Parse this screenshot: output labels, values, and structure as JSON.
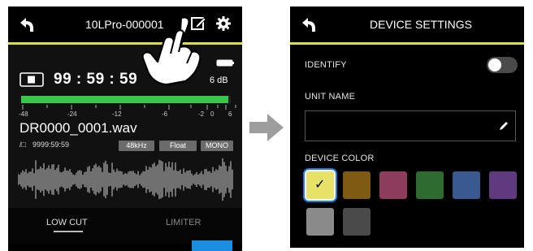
{
  "left_screen": {
    "header_title": "10LPro-000001",
    "timecode": "99 : 59 : 59",
    "level_readout": "6 dB",
    "scale_labels": [
      "-48",
      "-24",
      "-12",
      "-6",
      "-2",
      "0",
      "6"
    ],
    "file_name": "DR0000_0001.wav",
    "remaining_time": "9999:59:59",
    "format_tags": [
      "48kHz",
      "Float",
      "MONO"
    ],
    "tabs": [
      "LOW CUT",
      "LIMITER"
    ],
    "meter_level": 0.99
  },
  "right_screen": {
    "header_title": "DEVICE SETTINGS",
    "identify_label": "IDENTIFY",
    "identify_on": false,
    "unit_name_label": "UNIT NAME",
    "unit_name_value": "",
    "device_color_label": "DEVICE COLOR",
    "colors": [
      "#e6e267",
      "#7f5a12",
      "#8c3d5c",
      "#2e6b30",
      "#3a5a8f",
      "#5f3a7e",
      "#8a8a8a",
      "#4a4a4a"
    ],
    "selected_color_index": 0,
    "check_glyph": "✓"
  },
  "accent_color": "#d9df4a",
  "meter_color": "#38c84a"
}
